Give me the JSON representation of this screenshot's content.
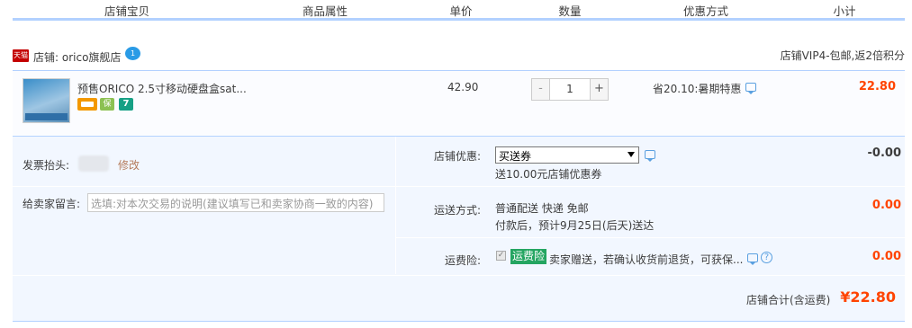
{
  "header": {
    "columns": [
      "店铺宝贝",
      "商品属性",
      "单价",
      "数量",
      "优惠方式",
      "小计"
    ]
  },
  "shop": {
    "badge": "天猫",
    "name": "店铺: orico旗舰店",
    "chat_badge": "1",
    "vip_text": "店铺VIP4-包邮,返2倍积分"
  },
  "item": {
    "title": "预售ORICO 2.5寸移动硬盘盒sat...",
    "service_badge_2": "保",
    "service_badge_3": "7",
    "unit_price": "42.90",
    "quantity": "1",
    "qty_minus": "-",
    "qty_plus": "+",
    "promotion": "省20.10:暑期特惠",
    "subtotal": "22.80"
  },
  "invoice": {
    "label": "发票抬头:",
    "edit_link": "修改"
  },
  "message": {
    "label": "给卖家留言:",
    "placeholder": "选填:对本次交易的说明(建议填写已和卖家协商一致的内容)"
  },
  "shop_discount": {
    "label": "店铺优惠:",
    "selected": "买送券",
    "note": "送10.00元店铺优惠券",
    "amount": "-0.00"
  },
  "shipping": {
    "label": "运送方式:",
    "method": "普通配送 快递 免邮",
    "eta": "付款后，预计9月25日(后天)送达",
    "amount": "0.00"
  },
  "insurance": {
    "label": "运费险:",
    "checked": true,
    "tag": "运费险",
    "text": "卖家赠送，若确认收货前退货，可获保...",
    "amount": "0.00"
  },
  "total": {
    "label": "店铺合计(含运费)",
    "amount": "¥22.80"
  },
  "colors": {
    "accent_line": "#b2d1ff",
    "price_red": "#ff4400",
    "panel_bg": "#f2f7ff",
    "insurance_green": "#24a561"
  }
}
